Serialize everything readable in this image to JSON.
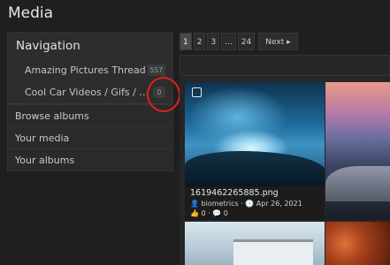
{
  "page": {
    "title": "Media"
  },
  "sidebar": {
    "heading": "Navigation",
    "sub_items": [
      {
        "label": "Amazing Pictures Thread",
        "count": "557"
      },
      {
        "label": "Cool Car Videos / Gifs / Pics...",
        "count": "0"
      }
    ],
    "items": [
      {
        "label": "Browse albums"
      },
      {
        "label": "Your media"
      },
      {
        "label": "Your albums"
      }
    ]
  },
  "pagination": {
    "pages": [
      "1",
      "2",
      "3",
      "...",
      "24"
    ],
    "current": "1",
    "next_label": "Next ▸"
  },
  "media": [
    {
      "filename": "1619462265885.png",
      "author": "biometrics",
      "date": "Apr 26, 2021",
      "reactions": "0",
      "comments": "0"
    }
  ],
  "colors": {
    "background": "#1f1f1f",
    "annotation": "#e2201c"
  }
}
